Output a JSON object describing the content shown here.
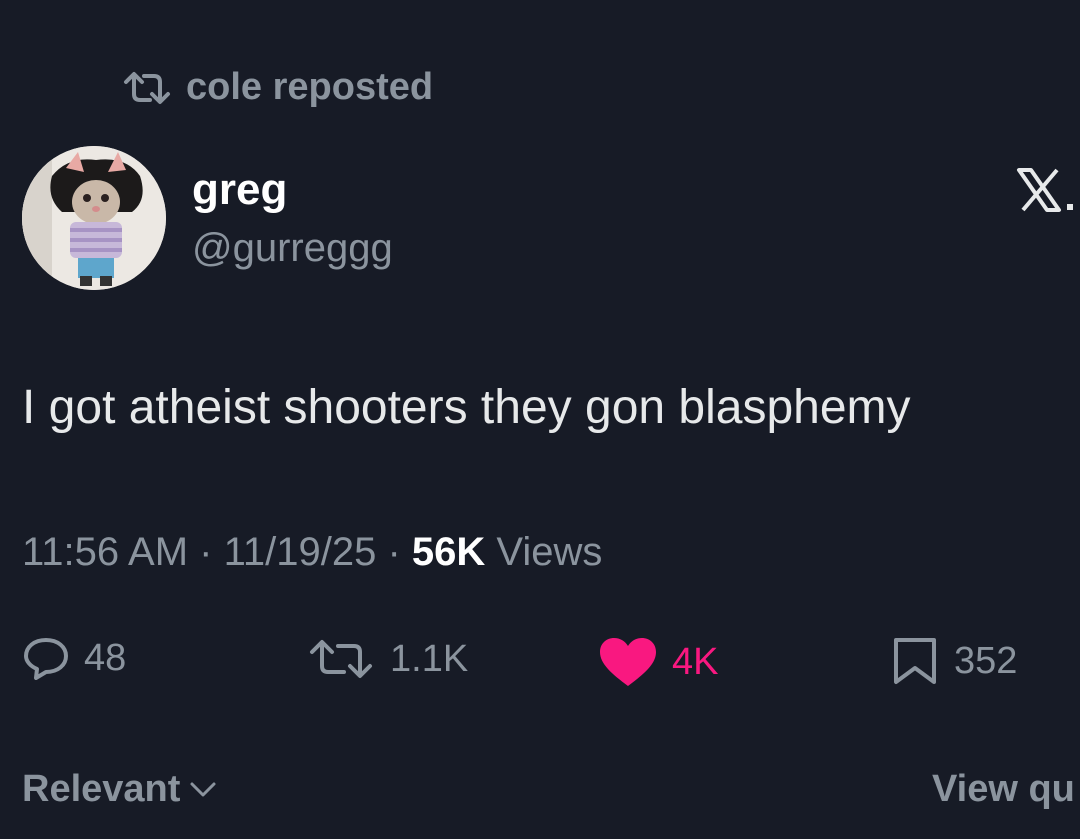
{
  "repost": {
    "text": "cole reposted",
    "icon": "repost-icon"
  },
  "author": {
    "display_name": "greg",
    "handle": "@gurreggg",
    "avatar": "avatar"
  },
  "platform": {
    "logo": "X."
  },
  "tweet": {
    "text": "I got atheist shooters they gon blasphemy"
  },
  "meta": {
    "time": "11:56 AM",
    "date": "11/19/25",
    "views_count": "56K",
    "views_label": "Views"
  },
  "stats": {
    "replies": "48",
    "reposts": "1.1K",
    "likes": "4K",
    "bookmarks": "352"
  },
  "footer": {
    "sort_label": "Relevant",
    "view_quotes_label": "View qu"
  },
  "colors": {
    "background": "#171b26",
    "muted": "#8b949e",
    "like": "#f91880",
    "text": "#e7e9ea"
  }
}
